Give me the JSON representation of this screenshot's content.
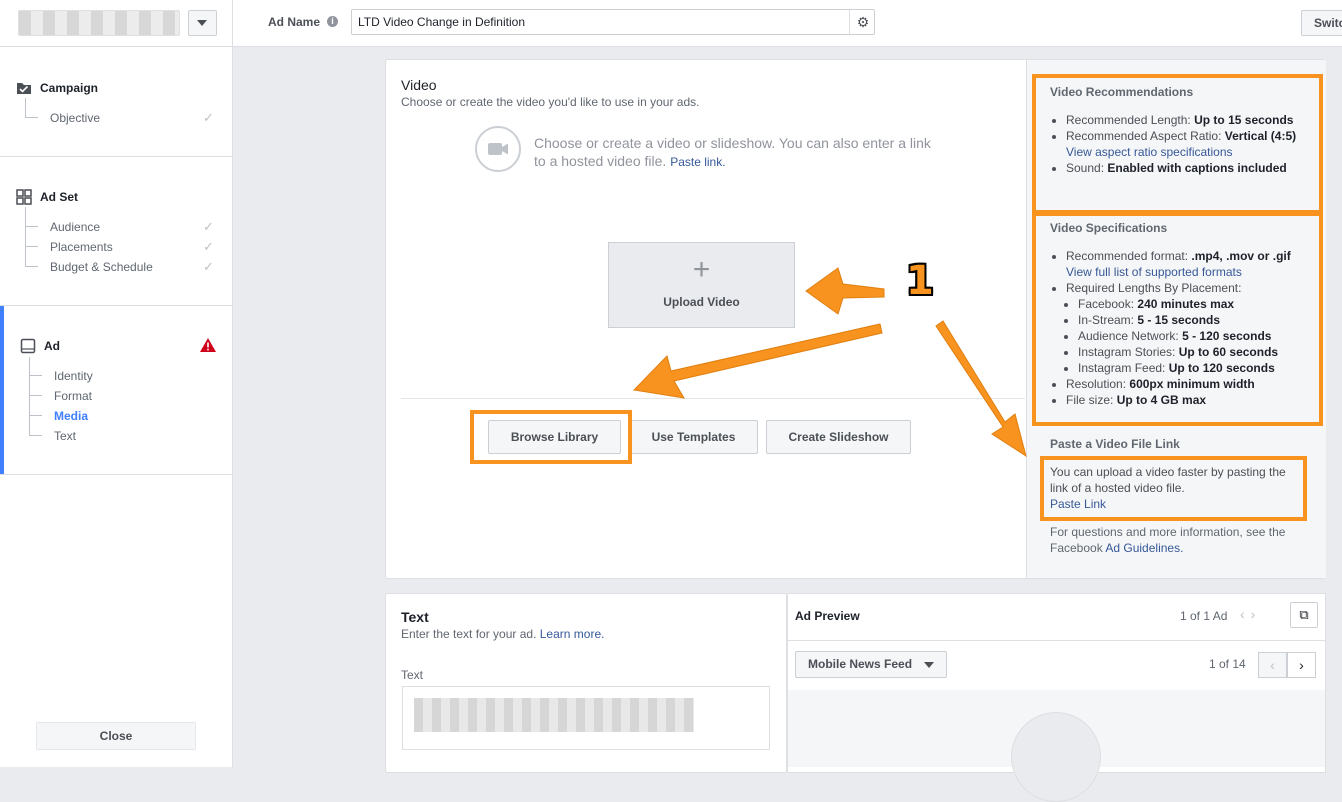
{
  "topbar": {
    "ad_name_label": "Ad Name",
    "ad_name_value": "LTD Video Change in Definition",
    "switch_label": "Switch"
  },
  "sidebar": {
    "campaign": {
      "title": "Campaign",
      "items": [
        "Objective"
      ]
    },
    "adset": {
      "title": "Ad Set",
      "items": [
        "Audience",
        "Placements",
        "Budget & Schedule"
      ]
    },
    "ad": {
      "title": "Ad",
      "items": [
        "Identity",
        "Format",
        "Media",
        "Text"
      ],
      "active_item": "Media"
    },
    "close_label": "Close"
  },
  "video": {
    "title": "Video",
    "subtitle": "Choose or create the video you'd like to use in your ads.",
    "prompt_text": "Choose or create a video or slideshow. You can also enter a link to a hosted video file.",
    "prompt_link": "Paste link.",
    "upload_label": "Upload Video",
    "buttons": {
      "browse": "Browse Library",
      "templates": "Use Templates",
      "slideshow": "Create Slideshow"
    }
  },
  "recommendations": {
    "title": "Video Recommendations",
    "length_label": "Recommended Length:",
    "length_value": "Up to 15 seconds",
    "ratio_label": "Recommended Aspect Ratio:",
    "ratio_value": "Vertical (4:5)",
    "ratio_link": "View aspect ratio specifications",
    "sound_label": "Sound:",
    "sound_value": "Enabled with captions included"
  },
  "specifications": {
    "title": "Video Specifications",
    "format_label": "Recommended format:",
    "format_value": ".mp4, .mov or .gif",
    "format_link": "View full list of supported formats",
    "lengths_label": "Required Lengths By Placement:",
    "placements": [
      {
        "name": "Facebook:",
        "value": "240 minutes max"
      },
      {
        "name": "In-Stream:",
        "value": "5 - 15 seconds"
      },
      {
        "name": "Audience Network:",
        "value": "5 - 120 seconds"
      },
      {
        "name": "Instagram Stories:",
        "value": "Up to 60 seconds"
      },
      {
        "name": "Instagram Feed:",
        "value": "Up to 120 seconds"
      }
    ],
    "resolution_label": "Resolution:",
    "resolution_value": "600px minimum width",
    "filesize_label": "File size:",
    "filesize_value": "Up to 4 GB max"
  },
  "paste_link": {
    "title": "Paste a Video File Link",
    "body": "You can upload a video faster by pasting the link of a hosted video file.",
    "link": "Paste Link",
    "guidelines_text": "For questions and more information, see the Facebook",
    "guidelines_link": "Ad Guidelines."
  },
  "text_section": {
    "title": "Text",
    "subtitle": "Enter the text for your ad.",
    "learn_more": "Learn more.",
    "field_label": "Text"
  },
  "preview": {
    "title": "Ad Preview",
    "ad_count": "1 of 1 Ad",
    "placement": "Mobile News Feed",
    "page_count": "1 of 14"
  },
  "annotation": {
    "number": "1",
    "highlight_color": "#f7931e"
  },
  "icons": {
    "info": "info-icon",
    "gear": "gear-icon",
    "camera": "video-camera-icon",
    "plus": "plus-icon",
    "warning": "warning-icon",
    "external": "external-link-icon"
  }
}
